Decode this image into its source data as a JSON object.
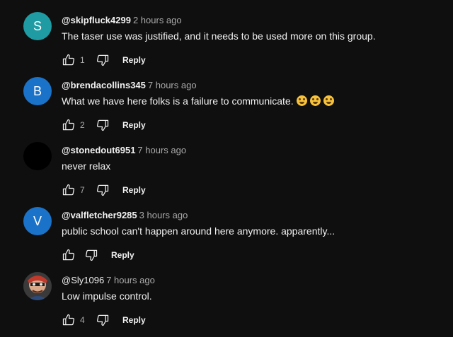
{
  "comments": [
    {
      "avatar_letter": "S",
      "avatar_color": "#1f9ca3",
      "handle": "@skipfluck4299",
      "time": "2 hours ago",
      "text": "The taser use was justified, and it needs to be used more on this group.",
      "likes": "1",
      "reply_label": "Reply"
    },
    {
      "avatar_letter": "B",
      "avatar_color": "#1a73c9",
      "handle": "@brendacollins345",
      "time": "7 hours ago",
      "text": "What we have here folks is a failure to communicate.",
      "emoji": [
        "grinning-face-emoji",
        "grinning-face-emoji",
        "grinning-face-emoji"
      ],
      "likes": "2",
      "reply_label": "Reply"
    },
    {
      "avatar_letter": "",
      "avatar_color": "#000000",
      "handle": "@stonedout6951",
      "time": "7 hours ago",
      "text": "never relax",
      "likes": "7",
      "reply_label": "Reply"
    },
    {
      "avatar_letter": "V",
      "avatar_color": "#1a73c9",
      "handle": "@valfletcher9285",
      "time": "3 hours ago",
      "text": "public school can't happen around here anymore. apparently...",
      "likes": "",
      "reply_label": "Reply"
    },
    {
      "avatar_letter": "",
      "avatar_color": "#2b2b2b",
      "avatar_image": "cartoon-character-avatar",
      "handle": "@Sly1096",
      "time": "7 hours ago",
      "text": "Low impulse control.",
      "likes": "4",
      "reply_label": "Reply"
    }
  ]
}
